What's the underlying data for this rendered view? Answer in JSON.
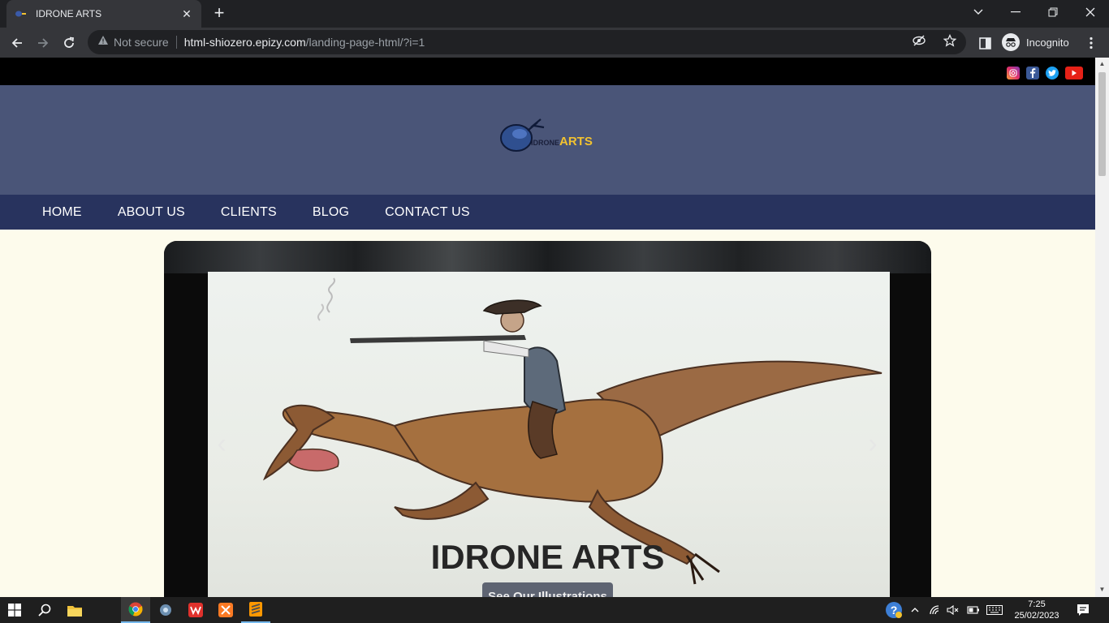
{
  "browser": {
    "tab_title": "IDRONE ARTS",
    "tab_close": "✕",
    "new_tab": "+",
    "address": {
      "security_text": "Not secure",
      "host": "html-shiozero.epizy.com",
      "path": "/landing-page-html/?i=1"
    },
    "profile_label": "Incognito"
  },
  "site": {
    "logo": {
      "prefix": "IDRONE",
      "suffix": "ARTS"
    },
    "social_icons": [
      "instagram-icon",
      "facebook-icon",
      "twitter-icon",
      "youtube-icon"
    ],
    "nav": {
      "items": [
        "HOME",
        "ABOUT US",
        "CLIENTS",
        "BLOG",
        "CONTACT US"
      ]
    },
    "hero": {
      "caption": "IDRONE ARTS",
      "button_label": "See Our Illustrations",
      "prev": "‹",
      "next": "›"
    },
    "colors": {
      "topbar": "#000000",
      "header": "#4a5578",
      "nav": "#28335e",
      "page_bg": "#fdfbec",
      "logo_accent": "#f2c230"
    }
  },
  "taskbar": {
    "time": "7:25",
    "date": "25/02/2023",
    "pinned": [
      "start-icon",
      "search-icon",
      "file-explorer-icon",
      "chrome-icon",
      "app-icon",
      "wps-icon",
      "xampp-icon",
      "sublime-icon"
    ]
  }
}
